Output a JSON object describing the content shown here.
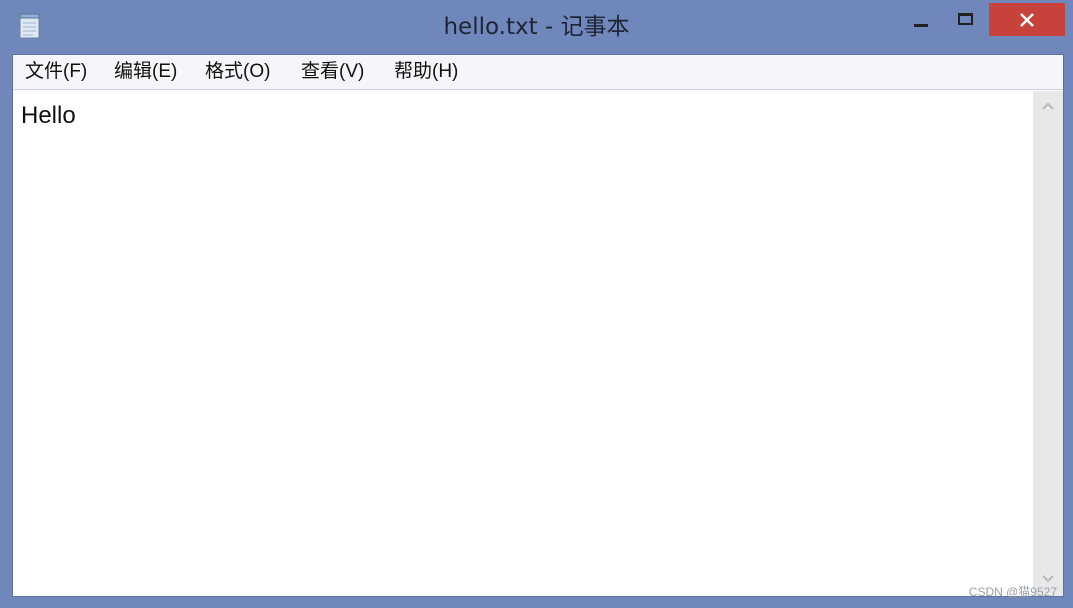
{
  "window": {
    "title": "hello.txt - 记事本",
    "icon": "notepad-icon",
    "controls": {
      "minimize_icon": "minimize-icon",
      "maximize_icon": "maximize-icon",
      "close_icon": "close-icon"
    }
  },
  "menubar": {
    "items": [
      {
        "label": "文件(F)"
      },
      {
        "label": "编辑(E)"
      },
      {
        "label": "格式(O)"
      },
      {
        "label": "查看(V)"
      },
      {
        "label": "帮助(H)"
      }
    ]
  },
  "editor": {
    "content": "Hello"
  },
  "watermark": "CSDN @猫9527",
  "colors": {
    "frame": "#6f87bb",
    "close": "#c7423b",
    "menubar": "#f4f6fa",
    "scrollbar": "#e8e8e8"
  }
}
